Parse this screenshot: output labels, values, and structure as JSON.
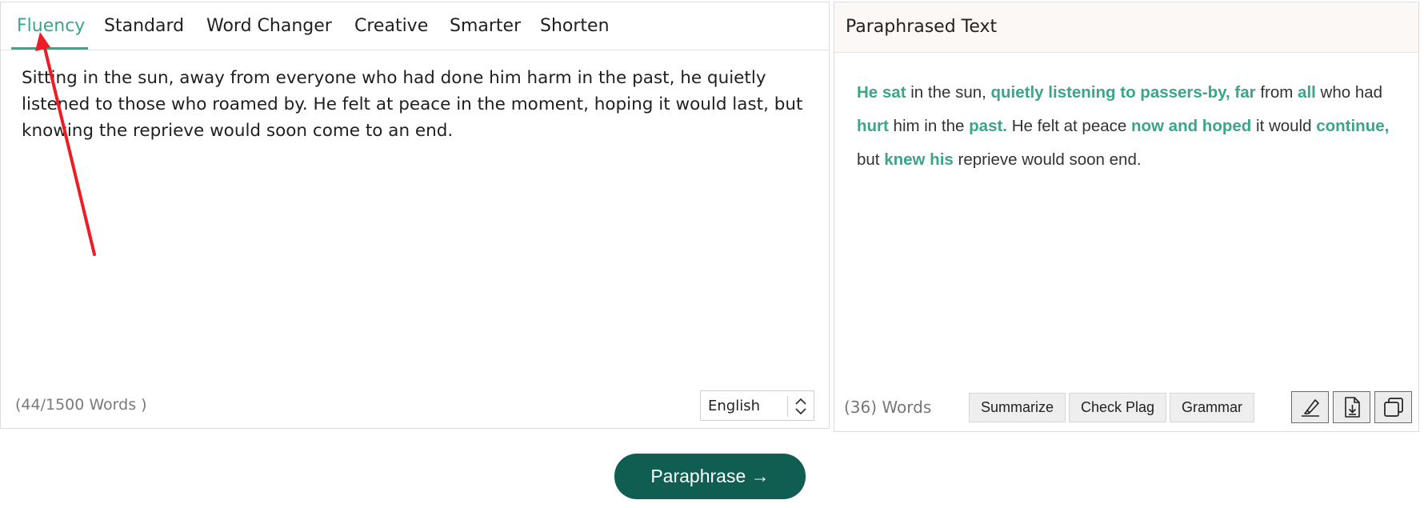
{
  "tabs": [
    {
      "label": "Fluency",
      "active": true
    },
    {
      "label": "Standard"
    },
    {
      "label": "Word Changer"
    },
    {
      "label": "Creative"
    },
    {
      "label": "Smarter"
    },
    {
      "label": "Shorten"
    }
  ],
  "input": {
    "text": "Sitting in the sun, away from everyone who had done him harm in the past, he quietly listened to those who roamed by. He felt at peace in the moment, hoping it would last, but knowing the reprieve would soon come to an end.",
    "word_count": "(44/1500 Words )",
    "language": "English"
  },
  "output": {
    "title": "Paraphrased Text",
    "segments": [
      {
        "t": "He sat",
        "hl": true
      },
      {
        "t": " in the sun, ",
        "hl": false
      },
      {
        "t": "quietly listening to passers-by, far",
        "hl": true
      },
      {
        "t": " from ",
        "hl": false
      },
      {
        "t": "all",
        "hl": true
      },
      {
        "t": " who had ",
        "hl": false
      },
      {
        "t": "hurt",
        "hl": true
      },
      {
        "t": " him in the ",
        "hl": false
      },
      {
        "t": "past.",
        "hl": true
      },
      {
        "t": " He felt at peace ",
        "hl": false
      },
      {
        "t": "now and hoped",
        "hl": true
      },
      {
        "t": " it would ",
        "hl": false
      },
      {
        "t": "continue,",
        "hl": true
      },
      {
        "t": " but ",
        "hl": false
      },
      {
        "t": "knew his",
        "hl": true
      },
      {
        "t": " reprieve would soon end.",
        "hl": false
      }
    ],
    "word_count": "(36) Words",
    "buttons": {
      "summarize": "Summarize",
      "check_plag": "Check Plag",
      "grammar": "Grammar"
    },
    "icons": [
      "highlighter-icon",
      "download-icon",
      "copy-icon"
    ]
  },
  "paraphrase_button": "Paraphrase →",
  "colors": {
    "accent": "#3aa58a",
    "button": "#105e52",
    "annotation": "#ee1c24"
  }
}
